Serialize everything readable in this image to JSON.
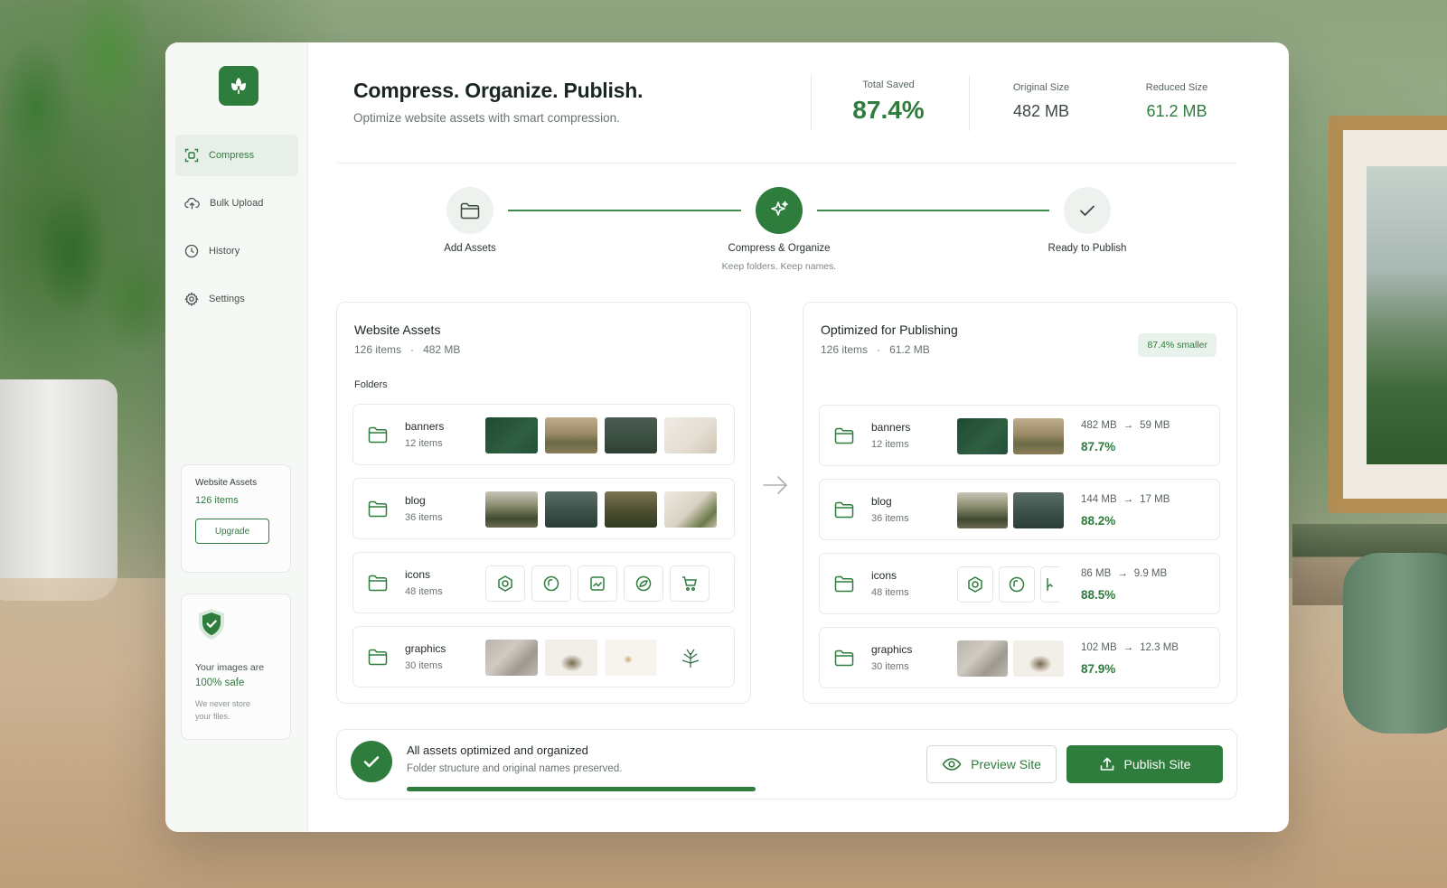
{
  "app": {
    "nav": [
      {
        "label": "Compress",
        "icon": "compress-icon",
        "active": true
      },
      {
        "label": "Bulk Upload",
        "icon": "cloud-upload-icon"
      },
      {
        "label": "History",
        "icon": "clock-icon"
      },
      {
        "label": "Settings",
        "icon": "gear-icon"
      }
    ],
    "assets_card": {
      "title": "Website Assets",
      "count": "126 items",
      "upgrade_label": "Upgrade"
    },
    "safe_card": {
      "text": "Your images are",
      "pct": "100% safe",
      "note": "We never store your files."
    }
  },
  "header": {
    "title": "Compress. Organize. Publish.",
    "subtitle": "Optimize website assets with smart compression."
  },
  "stats": [
    {
      "label": "Total Saved",
      "value": "87.4%"
    },
    {
      "label": "Original Size",
      "value": "482 MB"
    },
    {
      "label": "Reduced Size",
      "value": "61.2 MB"
    }
  ],
  "steps": [
    {
      "label": "Add Assets",
      "sub": ""
    },
    {
      "label": "Compress & Organize",
      "sub": "Keep folders. Keep names."
    },
    {
      "label": "Ready to Publish",
      "sub": ""
    }
  ],
  "source_panel": {
    "title": "Website Assets",
    "items": "126 items",
    "size": "482 MB",
    "folders_label": "Folders",
    "folders": [
      {
        "name": "banners",
        "count": "12 items"
      },
      {
        "name": "blog",
        "count": "36 items"
      },
      {
        "name": "icons",
        "count": "48 items"
      },
      {
        "name": "graphics",
        "count": "30 items"
      }
    ]
  },
  "optimized_panel": {
    "title": "Optimized for Publishing",
    "items": "126 items",
    "size": "61.2 MB",
    "badge": "87.4% smaller",
    "folders": [
      {
        "name": "banners",
        "count": "12 items",
        "from": "482 MB",
        "to": "59 MB",
        "pct": "87.7%"
      },
      {
        "name": "blog",
        "count": "36 items",
        "from": "144 MB",
        "to": "17 MB",
        "pct": "88.2%"
      },
      {
        "name": "icons",
        "count": "48 items",
        "from": "86 MB",
        "to": "9.9 MB",
        "pct": "88.5%"
      },
      {
        "name": "graphics",
        "count": "30 items",
        "from": "102 MB",
        "to": "12.3 MB",
        "pct": "87.9%"
      }
    ]
  },
  "footer": {
    "title": "All assets optimized and organized",
    "subtitle": "Folder structure and original names preserved.",
    "progress": 1.0,
    "preview_label": "Preview Site",
    "publish_label": "Publish Site"
  },
  "colors": {
    "accent": "#2e7d3d",
    "accent_light": "#e8f1ea"
  }
}
